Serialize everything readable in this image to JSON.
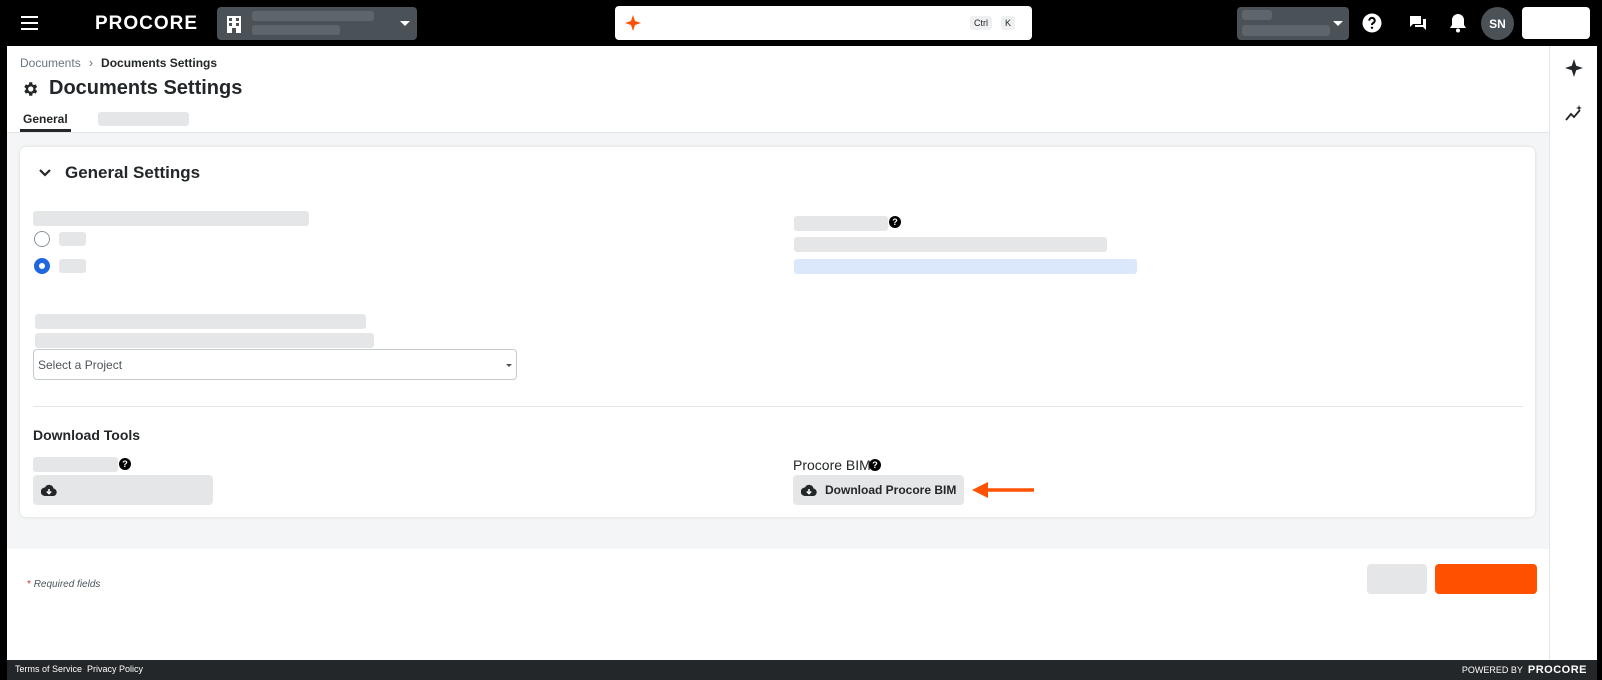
{
  "topbar": {
    "logo": "PROCORE",
    "search": {
      "kbd_ctrl": "Ctrl",
      "kbd_k": "K"
    },
    "user_initials": "SN"
  },
  "breadcrumb": {
    "parent": "Documents",
    "separator": "›",
    "current": "Documents Settings"
  },
  "page": {
    "title": "Documents Settings"
  },
  "tabs": [
    {
      "label": "General"
    }
  ],
  "general_settings": {
    "title": "General Settings",
    "radio_options": [
      {
        "selected": false
      },
      {
        "selected": true
      }
    ],
    "project_select": {
      "placeholder": "Select a Project"
    }
  },
  "download_tools": {
    "title": "Download Tools",
    "procore_bim": {
      "label": "Procore BIM",
      "help_glyph": "?",
      "button_label": "Download Procore BIM"
    }
  },
  "footer": {
    "required_star": "*",
    "required_text": "Required fields"
  },
  "bottom_bar": {
    "terms": "Terms of Service",
    "privacy": "Privacy Policy",
    "powered_by": "POWERED BY",
    "brand": "PROCORE"
  },
  "colors": {
    "accent": "#ff5100",
    "radio_selected": "#2066df",
    "topbar": "#000000",
    "annotation_arrow": "#ff5100"
  }
}
